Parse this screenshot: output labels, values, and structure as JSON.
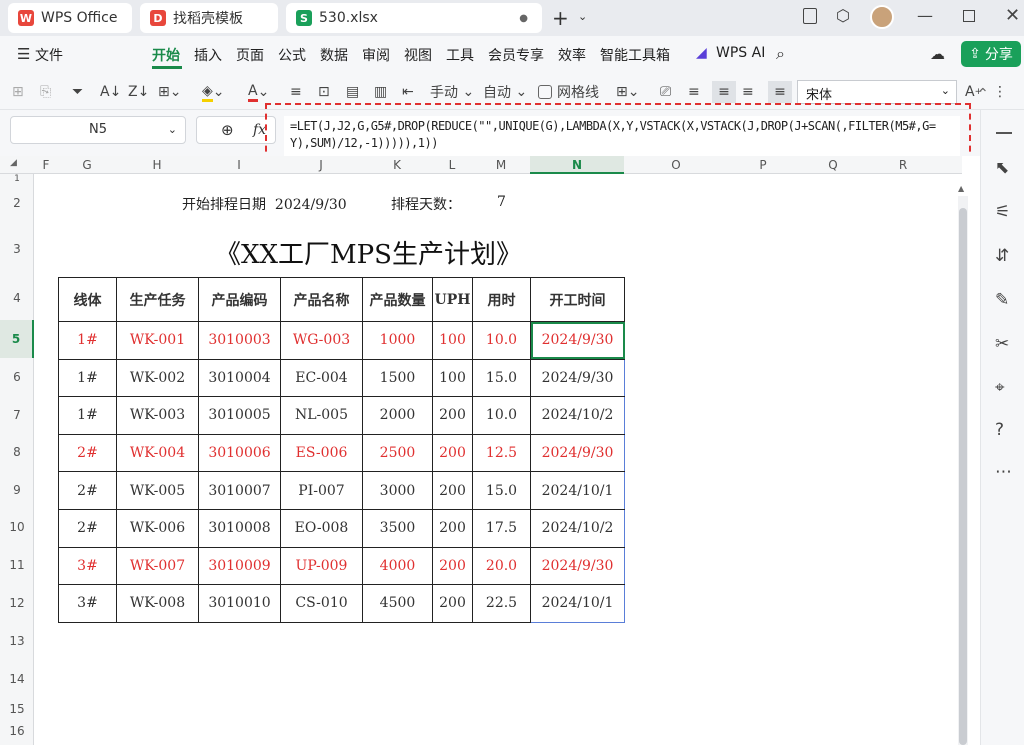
{
  "tabs": [
    {
      "label": "WPS Office"
    },
    {
      "label": "找稻壳模板"
    },
    {
      "label": "530.xlsx"
    }
  ],
  "menu": {
    "file": "文件",
    "items": [
      "开始",
      "插入",
      "页面",
      "公式",
      "数据",
      "审阅",
      "视图",
      "工具",
      "会员专享",
      "效率",
      "智能工具箱"
    ],
    "wps_ai": "WPS AI",
    "share": "分享"
  },
  "toolbar": {
    "manual": "手动",
    "auto": "自动",
    "gridlines": "网格线",
    "font": "宋体"
  },
  "formula": {
    "cellref": "N5",
    "fx": "fx",
    "text": "=LET(J,J2,G,G5#,DROP(REDUCE(\"\",UNIQUE(G),LAMBDA(X,Y,VSTACK(X,VSTACK(J,DROP(J+SCAN(,FILTER(M5#,G=Y),SUM)/12,-1))))),1))"
  },
  "columns": [
    "F",
    "G",
    "H",
    "I",
    "J",
    "K",
    "L",
    "M",
    "N",
    "O",
    "P",
    "Q",
    "R"
  ],
  "rows": [
    "1",
    "2",
    "3",
    "4",
    "5",
    "6",
    "7",
    "8",
    "9",
    "10",
    "11",
    "12",
    "13",
    "14",
    "15",
    "16"
  ],
  "sheet": {
    "start_label": "开始排程日期",
    "start_date": "2024/9/30",
    "days_label": "排程天数：",
    "days_value": "7",
    "title": "《XX工厂MPS生产计划》",
    "headers": [
      "线体",
      "生产任务",
      "产品编码",
      "产品名称",
      "产品数量",
      "UPH",
      "用时",
      "开工时间"
    ],
    "rows": [
      [
        "1#",
        "WK-001",
        "3010003",
        "WG-003",
        "1000",
        "100",
        "10.0",
        "2024/9/30"
      ],
      [
        "1#",
        "WK-002",
        "3010004",
        "EC-004",
        "1500",
        "100",
        "15.0",
        "2024/9/30"
      ],
      [
        "1#",
        "WK-003",
        "3010005",
        "NL-005",
        "2000",
        "200",
        "10.0",
        "2024/10/2"
      ],
      [
        "2#",
        "WK-004",
        "3010006",
        "ES-006",
        "2500",
        "200",
        "12.5",
        "2024/9/30"
      ],
      [
        "2#",
        "WK-005",
        "3010007",
        "PI-007",
        "3000",
        "200",
        "15.0",
        "2024/10/1"
      ],
      [
        "2#",
        "WK-006",
        "3010008",
        "EO-008",
        "3500",
        "200",
        "17.5",
        "2024/10/2"
      ],
      [
        "3#",
        "WK-007",
        "3010009",
        "UP-009",
        "4000",
        "200",
        "20.0",
        "2024/9/30"
      ],
      [
        "3#",
        "WK-008",
        "3010010",
        "CS-010",
        "4500",
        "200",
        "22.5",
        "2024/10/1"
      ]
    ]
  },
  "colors": {
    "red": "#e03030",
    "accent": "#1aa05a",
    "brand": "#e8473c",
    "highlight": "#e03030"
  }
}
